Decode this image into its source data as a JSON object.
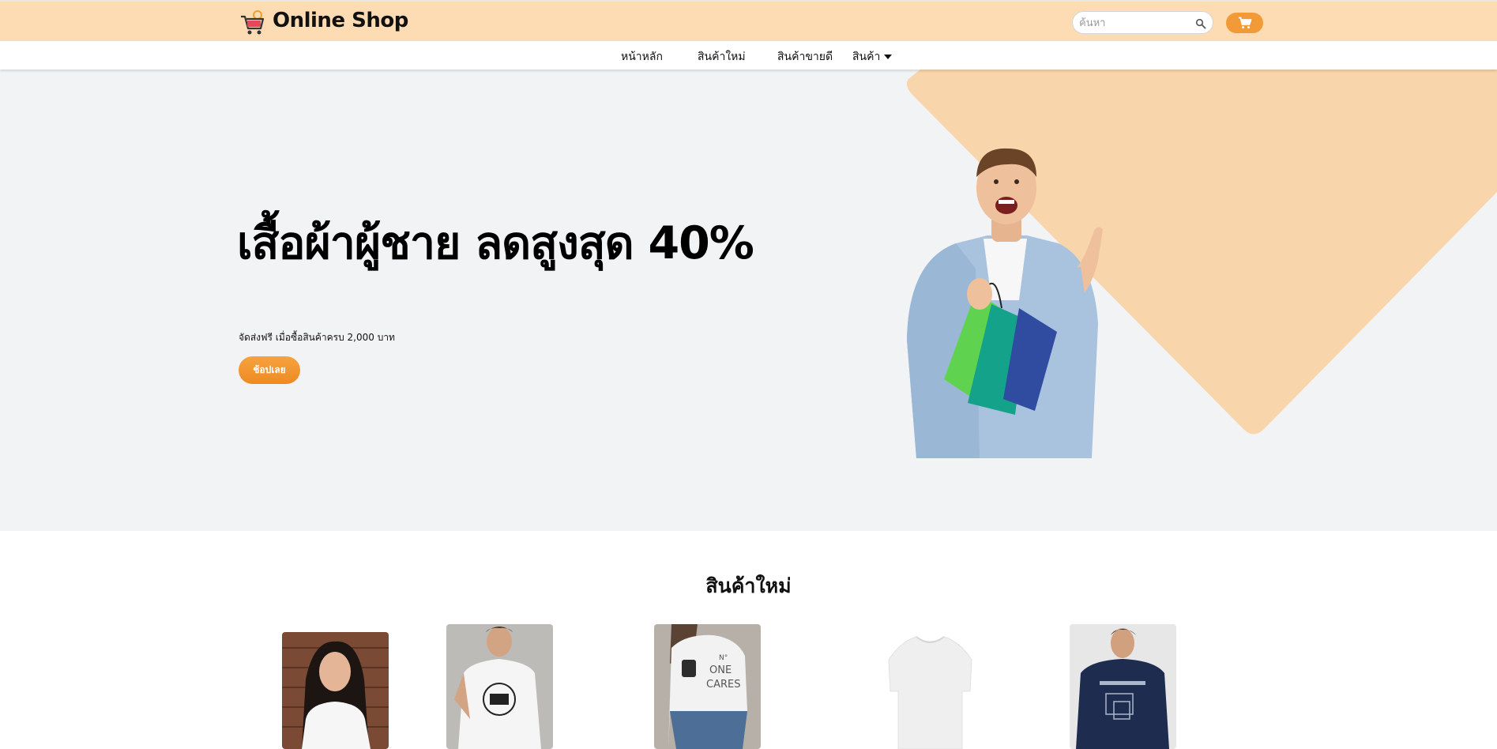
{
  "header": {
    "brand": "Online Shop",
    "search_placeholder": "ค้นหา",
    "logo_icon": "shopping-cart-logo-icon",
    "search_icon": "search-icon",
    "cart_icon": "cart-icon"
  },
  "nav": {
    "items": [
      {
        "label": "หน้าหลัก"
      },
      {
        "label": "สินค้าใหม่"
      },
      {
        "label": "สินค้าขายดี"
      },
      {
        "label": "สินค้า"
      }
    ]
  },
  "hero": {
    "title": "เสื้อผ้าผู้ชาย ลดสูงสุด 40%",
    "subtitle": "จัดส่งฟรี เมื่อซื้อสินค้าครบ 2,000 บาท",
    "button_label": "ช้อปเลย"
  },
  "new_products": {
    "title": "สินค้าใหม่",
    "items": [
      {
        "image": "woman-white-blouse"
      },
      {
        "image": "man-white-printed-tshirt"
      },
      {
        "image": "woman-no-one-cares-tshirt"
      },
      {
        "image": "plain-white-tshirt"
      },
      {
        "image": "navy-printed-tshirt"
      }
    ]
  },
  "colors": {
    "header_bg": "#fddcb3",
    "accent": "#f39a38",
    "hero_bg": "#f2f3f5",
    "hero_shape": "#f8d5aa"
  }
}
